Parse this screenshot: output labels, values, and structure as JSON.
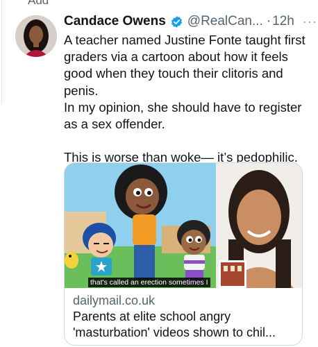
{
  "cut_off_text": "Add",
  "tweet": {
    "author_name": "Candace Owens",
    "handle": "@RealCan...",
    "separator": "·",
    "time": "12h",
    "more": "···",
    "paragraph1": "A teacher named Justine Fonte taught first graders via a cartoon about how it feels good when they touch their clitoris and penis.",
    "paragraph2": "In my opinion, she should have to register as a sex offender.",
    "paragraph3": "This is worse than woke— it’s pedophilic."
  },
  "card": {
    "caption": "that's called an erection sometimes I",
    "domain": "dailymail.co.uk",
    "title": "Parents at elite school angry 'masturbation' videos shown to chil..."
  },
  "colors": {
    "verified": "#1d9bf0",
    "secondary_text": "#536471",
    "border": "#cfd9de"
  },
  "icons": {
    "verified": "verified-badge-icon",
    "more": "more-options-icon"
  }
}
